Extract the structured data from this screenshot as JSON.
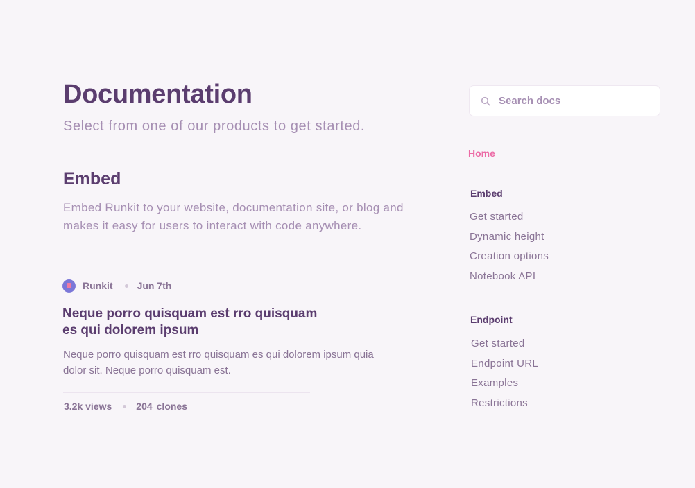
{
  "header": {
    "title": "Documentation",
    "subtitle": "Select from one of our products to get started."
  },
  "section": {
    "title": "Embed",
    "description": "Embed Runkit to your website, documentation site, or blog and makes it easy for users to interact with code anywhere."
  },
  "post": {
    "author": "Runkit",
    "date": "Jun 7th",
    "title": "Neque porro quisquam est rro quisquam es qui dolorem ipsum",
    "excerpt": "Neque porro quisquam est rro quisquam es qui dolorem ipsum quia dolor sit. Neque porro quisquam est.",
    "views": "3.2k views",
    "clones_count": "204",
    "clones_label": "clones"
  },
  "search": {
    "placeholder": "Search docs"
  },
  "nav": {
    "home": "Home",
    "groups": [
      {
        "title": "Embed",
        "items": [
          "Get started",
          "Dynamic height",
          "Creation options",
          "Notebook API"
        ]
      },
      {
        "title": "Endpoint",
        "items": [
          "Get started",
          "Endpoint URL",
          "Examples",
          "Restrictions"
        ]
      }
    ]
  },
  "colors": {
    "background": "#f8f5f9",
    "heading": "#5b3d6f",
    "muted": "#a68fb3",
    "accent": "#ec6ba6"
  }
}
